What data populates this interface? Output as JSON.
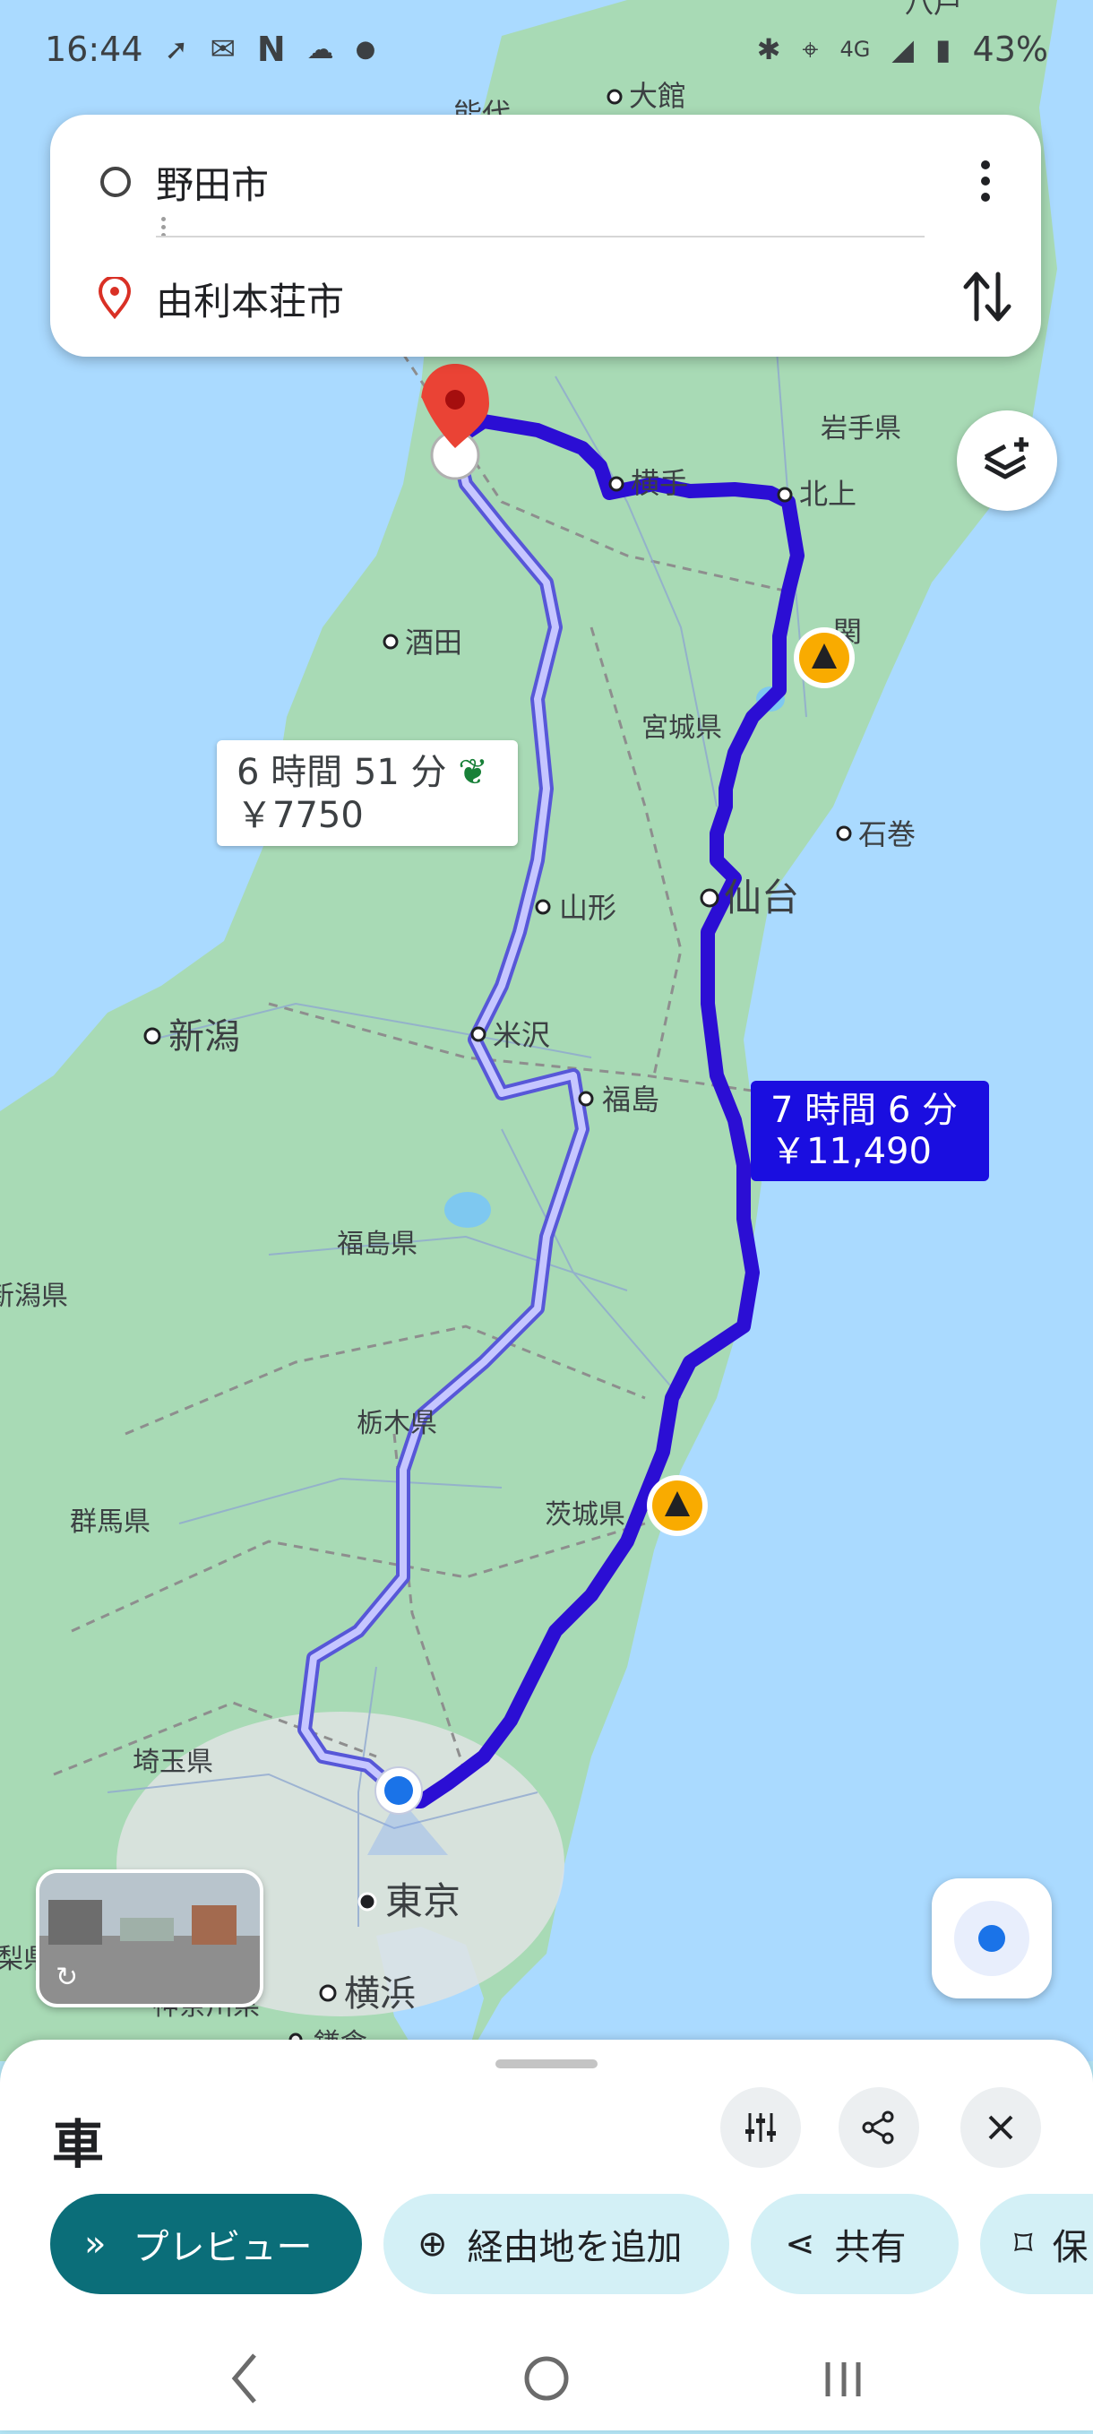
{
  "status_bar": {
    "time": "16:44",
    "network": "4G",
    "battery": "43%"
  },
  "route_card": {
    "origin": "野田市",
    "destination": "由利本荘市"
  },
  "map": {
    "places": {
      "odate": "大館",
      "iwate": "岩手県",
      "yokote": "横手",
      "kitakami": "北上",
      "ichinoseki": "関",
      "sakata": "酒田",
      "miyagi": "宮城県",
      "ishinomaki": "石巻",
      "yamagata": "山形",
      "sendai": "仙台",
      "niigata": "新潟",
      "yonezawa": "米沢",
      "fukushima": "福島",
      "fukushima_pref": "福島県",
      "niigata_pref": "新潟県",
      "tochigi": "栃木県",
      "gunma": "群馬県",
      "ibaraki": "茨城県",
      "saitama": "埼玉県",
      "tokyo": "東京",
      "yokohama": "横浜",
      "kanagawa": "神奈川県",
      "kamakura": "鎌倉",
      "yamanashi": "梨県",
      "noshiro": "能代",
      "hachinohe": "八戸"
    },
    "alt_route_label": {
      "time": "6 時間 51 分",
      "toll": "￥7750"
    },
    "main_route_label": {
      "time": "7 時間 6 分",
      "toll": "￥11,490"
    },
    "colors": {
      "main_route": "#2b0ed4",
      "alt_route": "#8c8cf0",
      "land": "#a8dab5",
      "sea": "#aadaff",
      "pin": "#ea4335",
      "construction": "#f9ab00"
    }
  },
  "sheet": {
    "mode": "車",
    "chips": {
      "preview": "プレビュー",
      "add_stop": "経由地を追加",
      "share": "共有",
      "save": "保"
    }
  }
}
